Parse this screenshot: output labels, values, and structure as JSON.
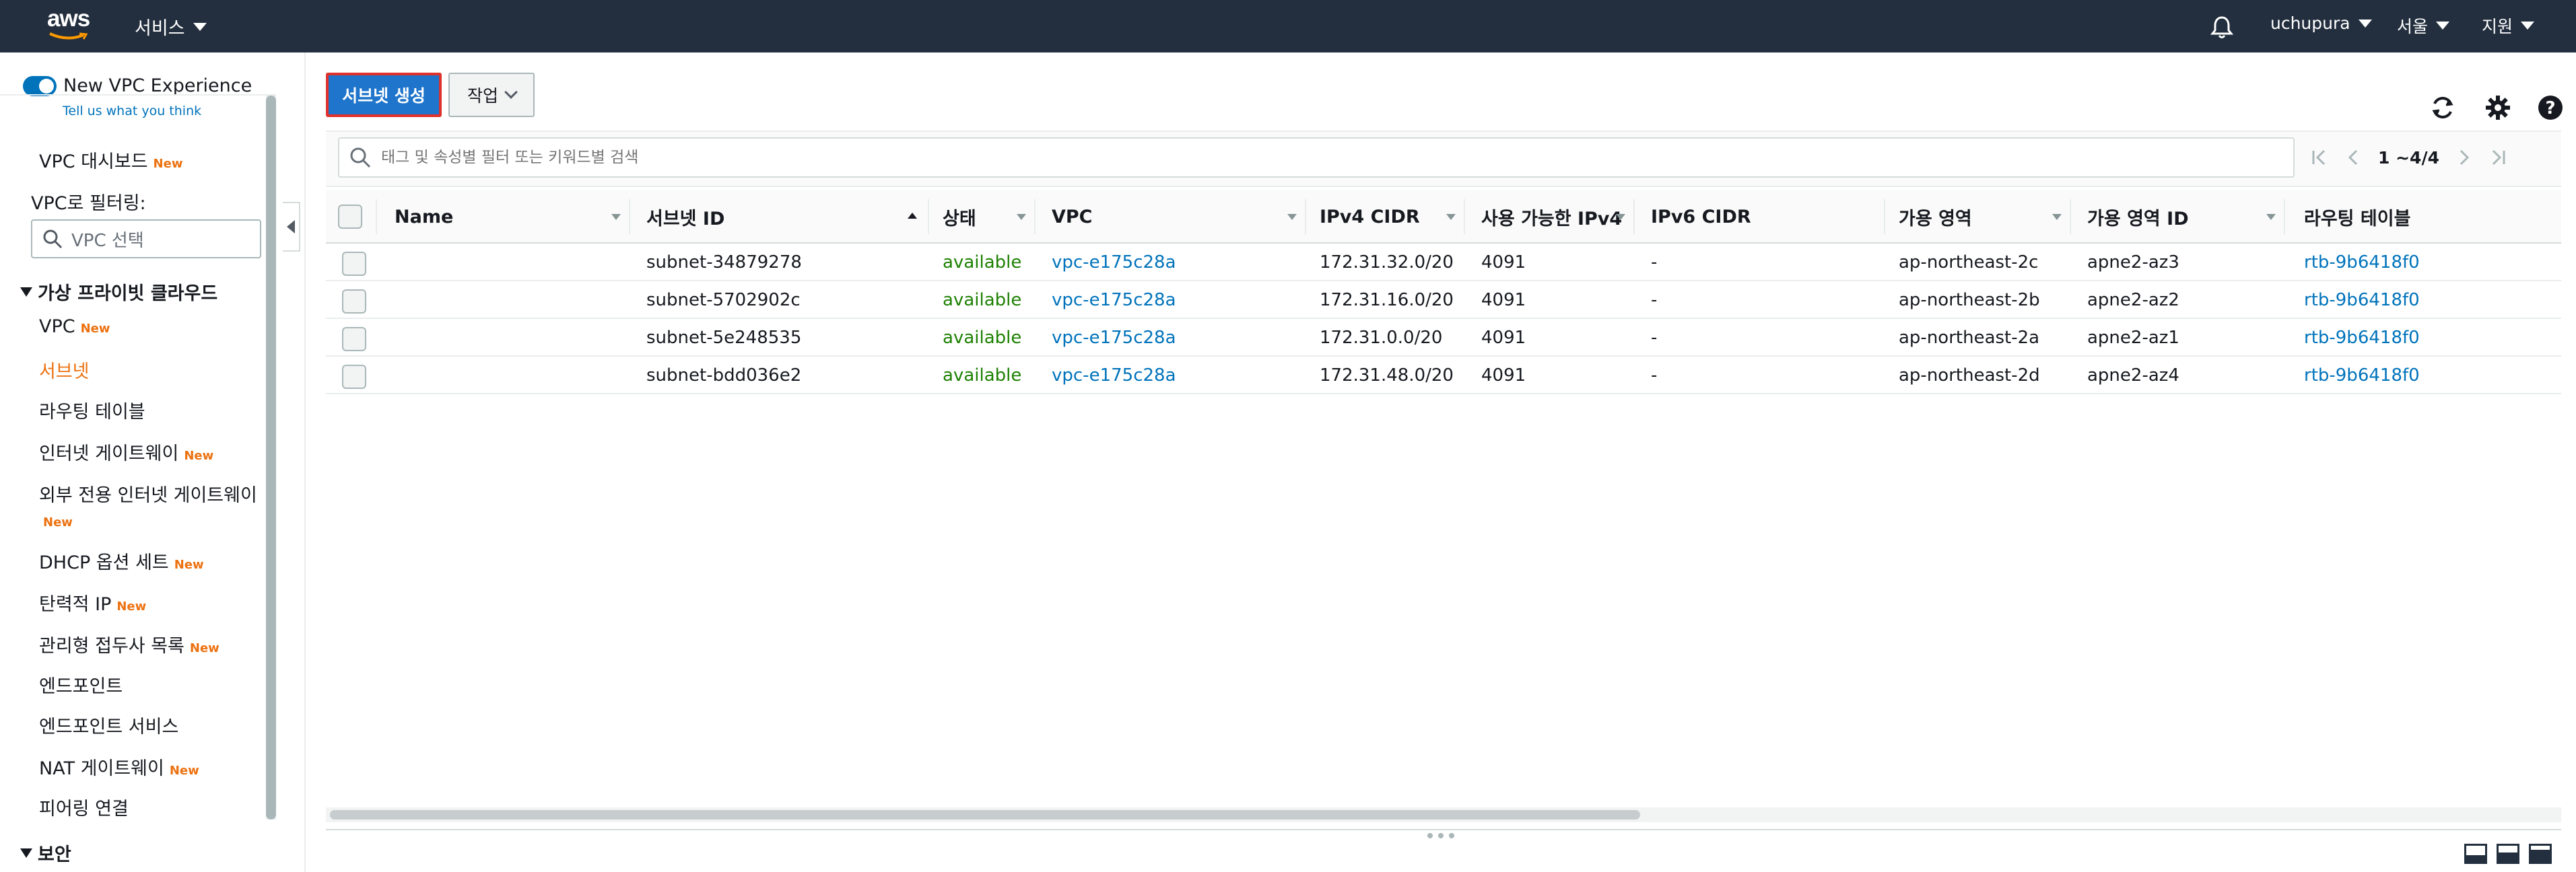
{
  "topnav": {
    "logo_text": "aws",
    "services_label": "서비스",
    "user_label": "uchupura",
    "region_label": "서울",
    "support_label": "지원"
  },
  "sidebar": {
    "toggle_label": "New VPC Experience",
    "tell_us": "Tell us what you think",
    "dashboard": {
      "label": "VPC 대시보드",
      "badge": "New"
    },
    "filter_label": "VPC로 필터링:",
    "vpc_select_placeholder": "VPC 선택",
    "section_vpc": "가상 프라이빗 클라우드",
    "items": [
      {
        "label": "VPC",
        "badge": "New"
      },
      {
        "label": "서브넷",
        "badge": ""
      },
      {
        "label": "라우팅 테이블",
        "badge": ""
      },
      {
        "label": "인터넷 게이트웨이",
        "badge": "New"
      },
      {
        "label": "외부 전용 인터넷 게이트웨이",
        "badge": "New"
      },
      {
        "label": "DHCP 옵션 세트",
        "badge": "New"
      },
      {
        "label": "탄력적 IP",
        "badge": "New"
      },
      {
        "label": "관리형 접두사 목록",
        "badge": "New"
      },
      {
        "label": "엔드포인트",
        "badge": ""
      },
      {
        "label": "엔드포인트 서비스",
        "badge": ""
      },
      {
        "label": "NAT 게이트웨이",
        "badge": "New"
      },
      {
        "label": "피어링 연결",
        "badge": ""
      }
    ],
    "section_security": "보안"
  },
  "main": {
    "create_button": "서브넷 생성",
    "actions_button": "작업",
    "search_placeholder": "태그 및 속성별 필터 또는 키워드별 검색",
    "pagination": "1 ~4/4",
    "columns": [
      "Name",
      "서브넷 ID",
      "상태",
      "VPC",
      "IPv4 CIDR",
      "사용 가능한 IPv4",
      "IPv6 CIDR",
      "가용 영역",
      "가용 영역 ID",
      "라우팅 테이블"
    ],
    "rows": [
      {
        "name": "",
        "subnet_id": "subnet-34879278",
        "state": "available",
        "vpc": "vpc-e175c28a",
        "ipv4": "172.31.32.0/20",
        "avail": "4091",
        "ipv6": "-",
        "az": "ap-northeast-2c",
        "az_id": "apne2-az3",
        "rtb": "rtb-9b6418f0"
      },
      {
        "name": "",
        "subnet_id": "subnet-5702902c",
        "state": "available",
        "vpc": "vpc-e175c28a",
        "ipv4": "172.31.16.0/20",
        "avail": "4091",
        "ipv6": "-",
        "az": "ap-northeast-2b",
        "az_id": "apne2-az2",
        "rtb": "rtb-9b6418f0"
      },
      {
        "name": "",
        "subnet_id": "subnet-5e248535",
        "state": "available",
        "vpc": "vpc-e175c28a",
        "ipv4": "172.31.0.0/20",
        "avail": "4091",
        "ipv6": "-",
        "az": "ap-northeast-2a",
        "az_id": "apne2-az1",
        "rtb": "rtb-9b6418f0"
      },
      {
        "name": "",
        "subnet_id": "subnet-bdd036e2",
        "state": "available",
        "vpc": "vpc-e175c28a",
        "ipv4": "172.31.48.0/20",
        "avail": "4091",
        "ipv6": "-",
        "az": "ap-northeast-2d",
        "az_id": "apne2-az4",
        "rtb": "rtb-9b6418f0"
      }
    ]
  },
  "colors": {
    "nav_bg": "#232f3e",
    "accent_orange": "#ec7211",
    "link_blue": "#0073bb",
    "status_green": "#1d8102",
    "primary_button": "#1f75cb",
    "highlight_border": "#e0312b"
  }
}
